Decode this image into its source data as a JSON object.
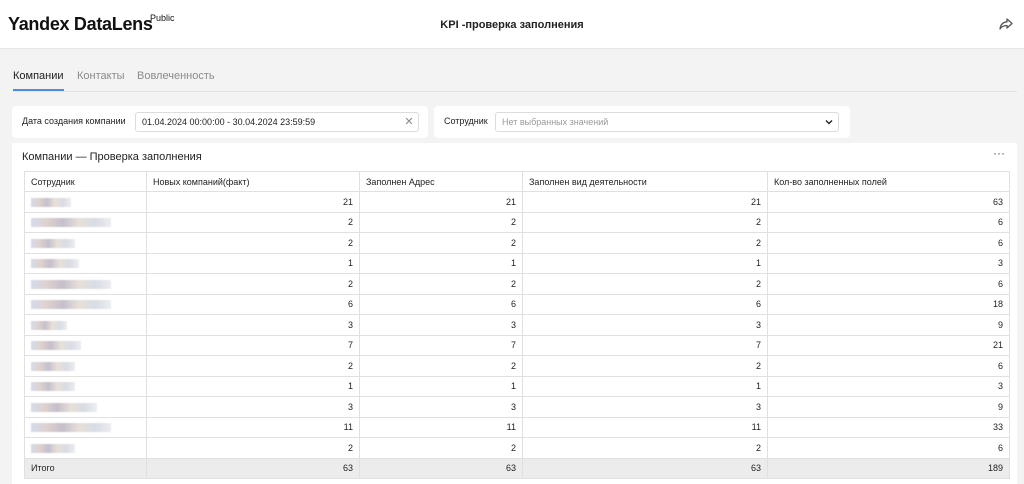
{
  "header": {
    "logo_text": "Yandex DataLens",
    "logo_badge": "Public",
    "title": "KPI -проверка заполнения",
    "share_icon": "share-icon"
  },
  "tabs": [
    {
      "label": "Компании",
      "active": true
    },
    {
      "label": "Контакты",
      "active": false
    },
    {
      "label": "Вовлеченность",
      "active": false
    }
  ],
  "filters": {
    "date": {
      "label": "Дата создания компании",
      "value": "01.04.2024 00:00:00 - 30.04.2024 23:59:59"
    },
    "employee": {
      "label": "Сотрудник",
      "placeholder": "Нет выбранных значений"
    }
  },
  "widget": {
    "title": "Компании — Проверка заполнения",
    "menu": "···"
  },
  "table": {
    "columns": [
      "Сотрудник",
      "Новых компаний(факт)",
      "Заполнен Адрес",
      "Заполнен вид деятельности",
      "Кол-во заполненных полей"
    ],
    "rows": [
      [
        "21",
        "21",
        "21",
        "63"
      ],
      [
        "2",
        "2",
        "2",
        "6"
      ],
      [
        "2",
        "2",
        "2",
        "6"
      ],
      [
        "1",
        "1",
        "1",
        "3"
      ],
      [
        "2",
        "2",
        "2",
        "6"
      ],
      [
        "6",
        "6",
        "6",
        "18"
      ],
      [
        "3",
        "3",
        "3",
        "9"
      ],
      [
        "7",
        "7",
        "7",
        "21"
      ],
      [
        "2",
        "2",
        "2",
        "6"
      ],
      [
        "1",
        "1",
        "1",
        "3"
      ],
      [
        "3",
        "3",
        "3",
        "9"
      ],
      [
        "11",
        "11",
        "11",
        "33"
      ],
      [
        "2",
        "2",
        "2",
        "6"
      ]
    ],
    "total": [
      "Итого",
      "63",
      "63",
      "63",
      "189"
    ]
  }
}
